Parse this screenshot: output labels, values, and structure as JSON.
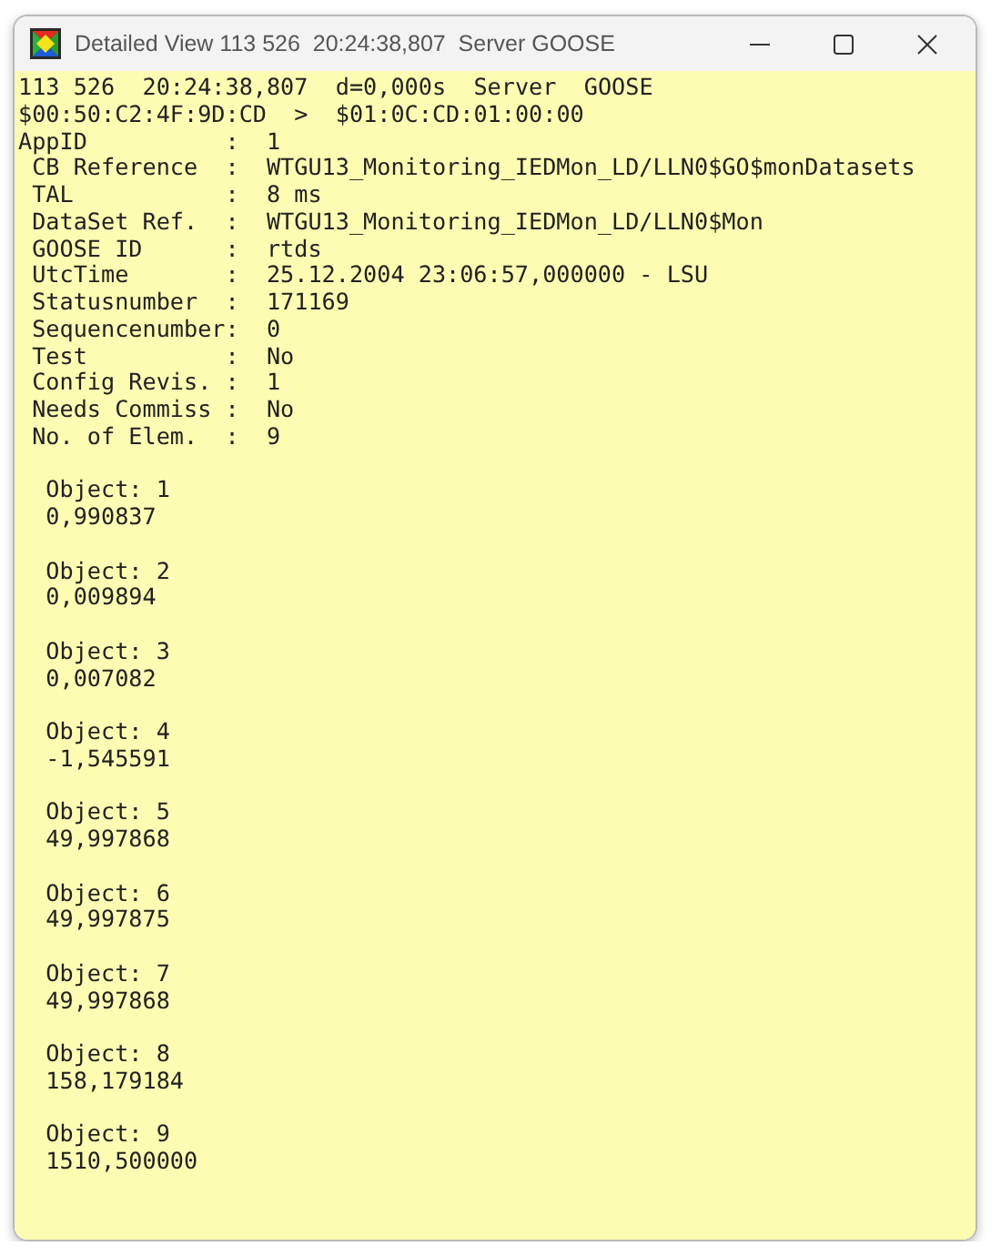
{
  "window": {
    "title": "Detailed View 113 526  20:24:38,807  Server GOOSE"
  },
  "header_lines": [
    "113 526  20:24:38,807  d=0,000s  Server  GOOSE",
    "$00:50:C2:4F:9D:CD  >  $01:0C:CD:01:00:00"
  ],
  "fields": [
    {
      "label": "AppID",
      "colon": ":",
      "value": "1",
      "indented": false
    },
    {
      "label": "CB Reference",
      "colon": ":",
      "value": "WTGU13_Monitoring_IEDMon_LD/LLN0$GO$monDatasets",
      "indented": true
    },
    {
      "label": "TAL",
      "colon": ":",
      "value": "8 ms",
      "indented": true
    },
    {
      "label": "DataSet Ref.",
      "colon": ":",
      "value": "WTGU13_Monitoring_IEDMon_LD/LLN0$Mon",
      "indented": true
    },
    {
      "label": "GOOSE ID",
      "colon": ":",
      "value": "rtds",
      "indented": true
    },
    {
      "label": "UtcTime",
      "colon": ":",
      "value": "25.12.2004 23:06:57,000000 - LSU",
      "indented": true
    },
    {
      "label": "Statusnumber",
      "colon": ":",
      "value": "171169",
      "indented": true
    },
    {
      "label": "Sequencenumber",
      "colon": ":",
      "value": "0",
      "indented": true
    },
    {
      "label": "Test",
      "colon": ":",
      "value": "No",
      "indented": true
    },
    {
      "label": "Config Revis.",
      "colon": ":",
      "value": "1",
      "indented": true
    },
    {
      "label": "Needs Commiss",
      "colon": ":",
      "value": "No",
      "indented": true
    },
    {
      "label": "No. of Elem.",
      "colon": ":",
      "value": "9",
      "indented": true
    }
  ],
  "objects": [
    {
      "title": "Object: 1",
      "value": "0,990837"
    },
    {
      "title": "Object: 2",
      "value": "0,009894"
    },
    {
      "title": "Object: 3",
      "value": "0,007082"
    },
    {
      "title": "Object: 4",
      "value": "-1,545591"
    },
    {
      "title": "Object: 5",
      "value": "49,997868"
    },
    {
      "title": "Object: 6",
      "value": "49,997875"
    },
    {
      "title": "Object: 7",
      "value": "49,997868"
    },
    {
      "title": "Object: 8",
      "value": "158,179184"
    },
    {
      "title": "Object: 9",
      "value": "1510,500000"
    }
  ]
}
